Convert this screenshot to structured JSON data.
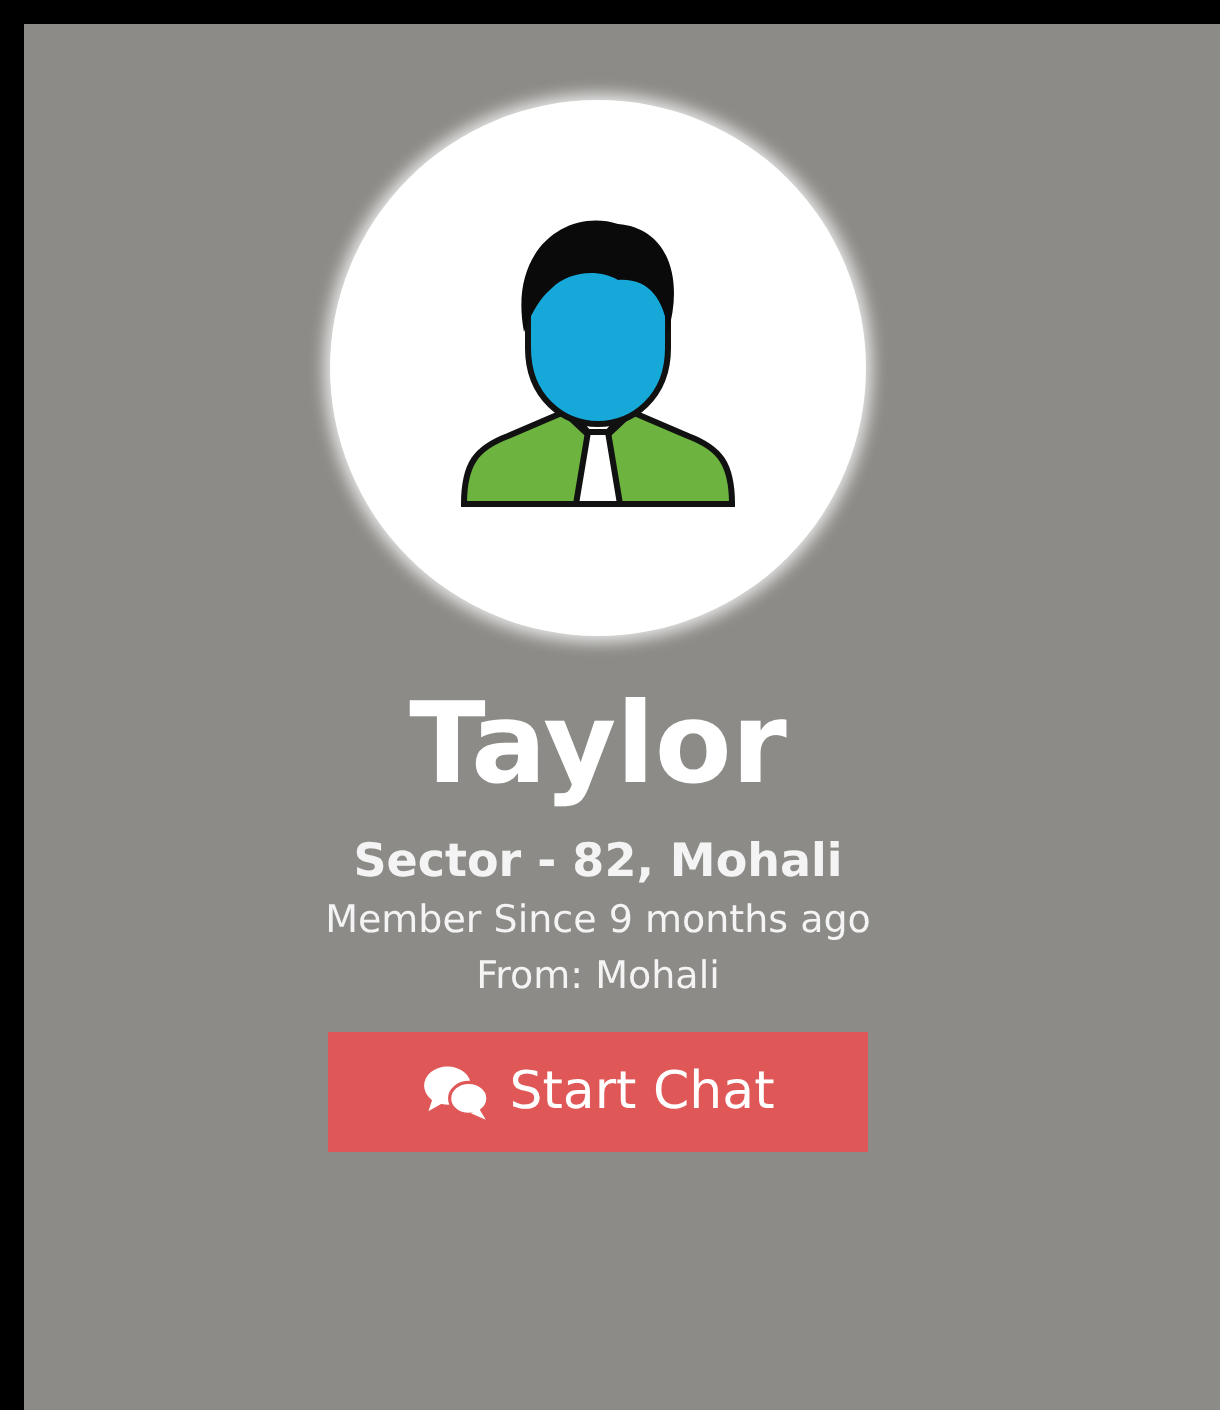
{
  "profile": {
    "name": "Taylor",
    "location": "Sector - 82, Mohali",
    "member_since": "Member Since 9 months ago",
    "from": "From: Mohali"
  },
  "button": {
    "label": "Start Chat"
  }
}
